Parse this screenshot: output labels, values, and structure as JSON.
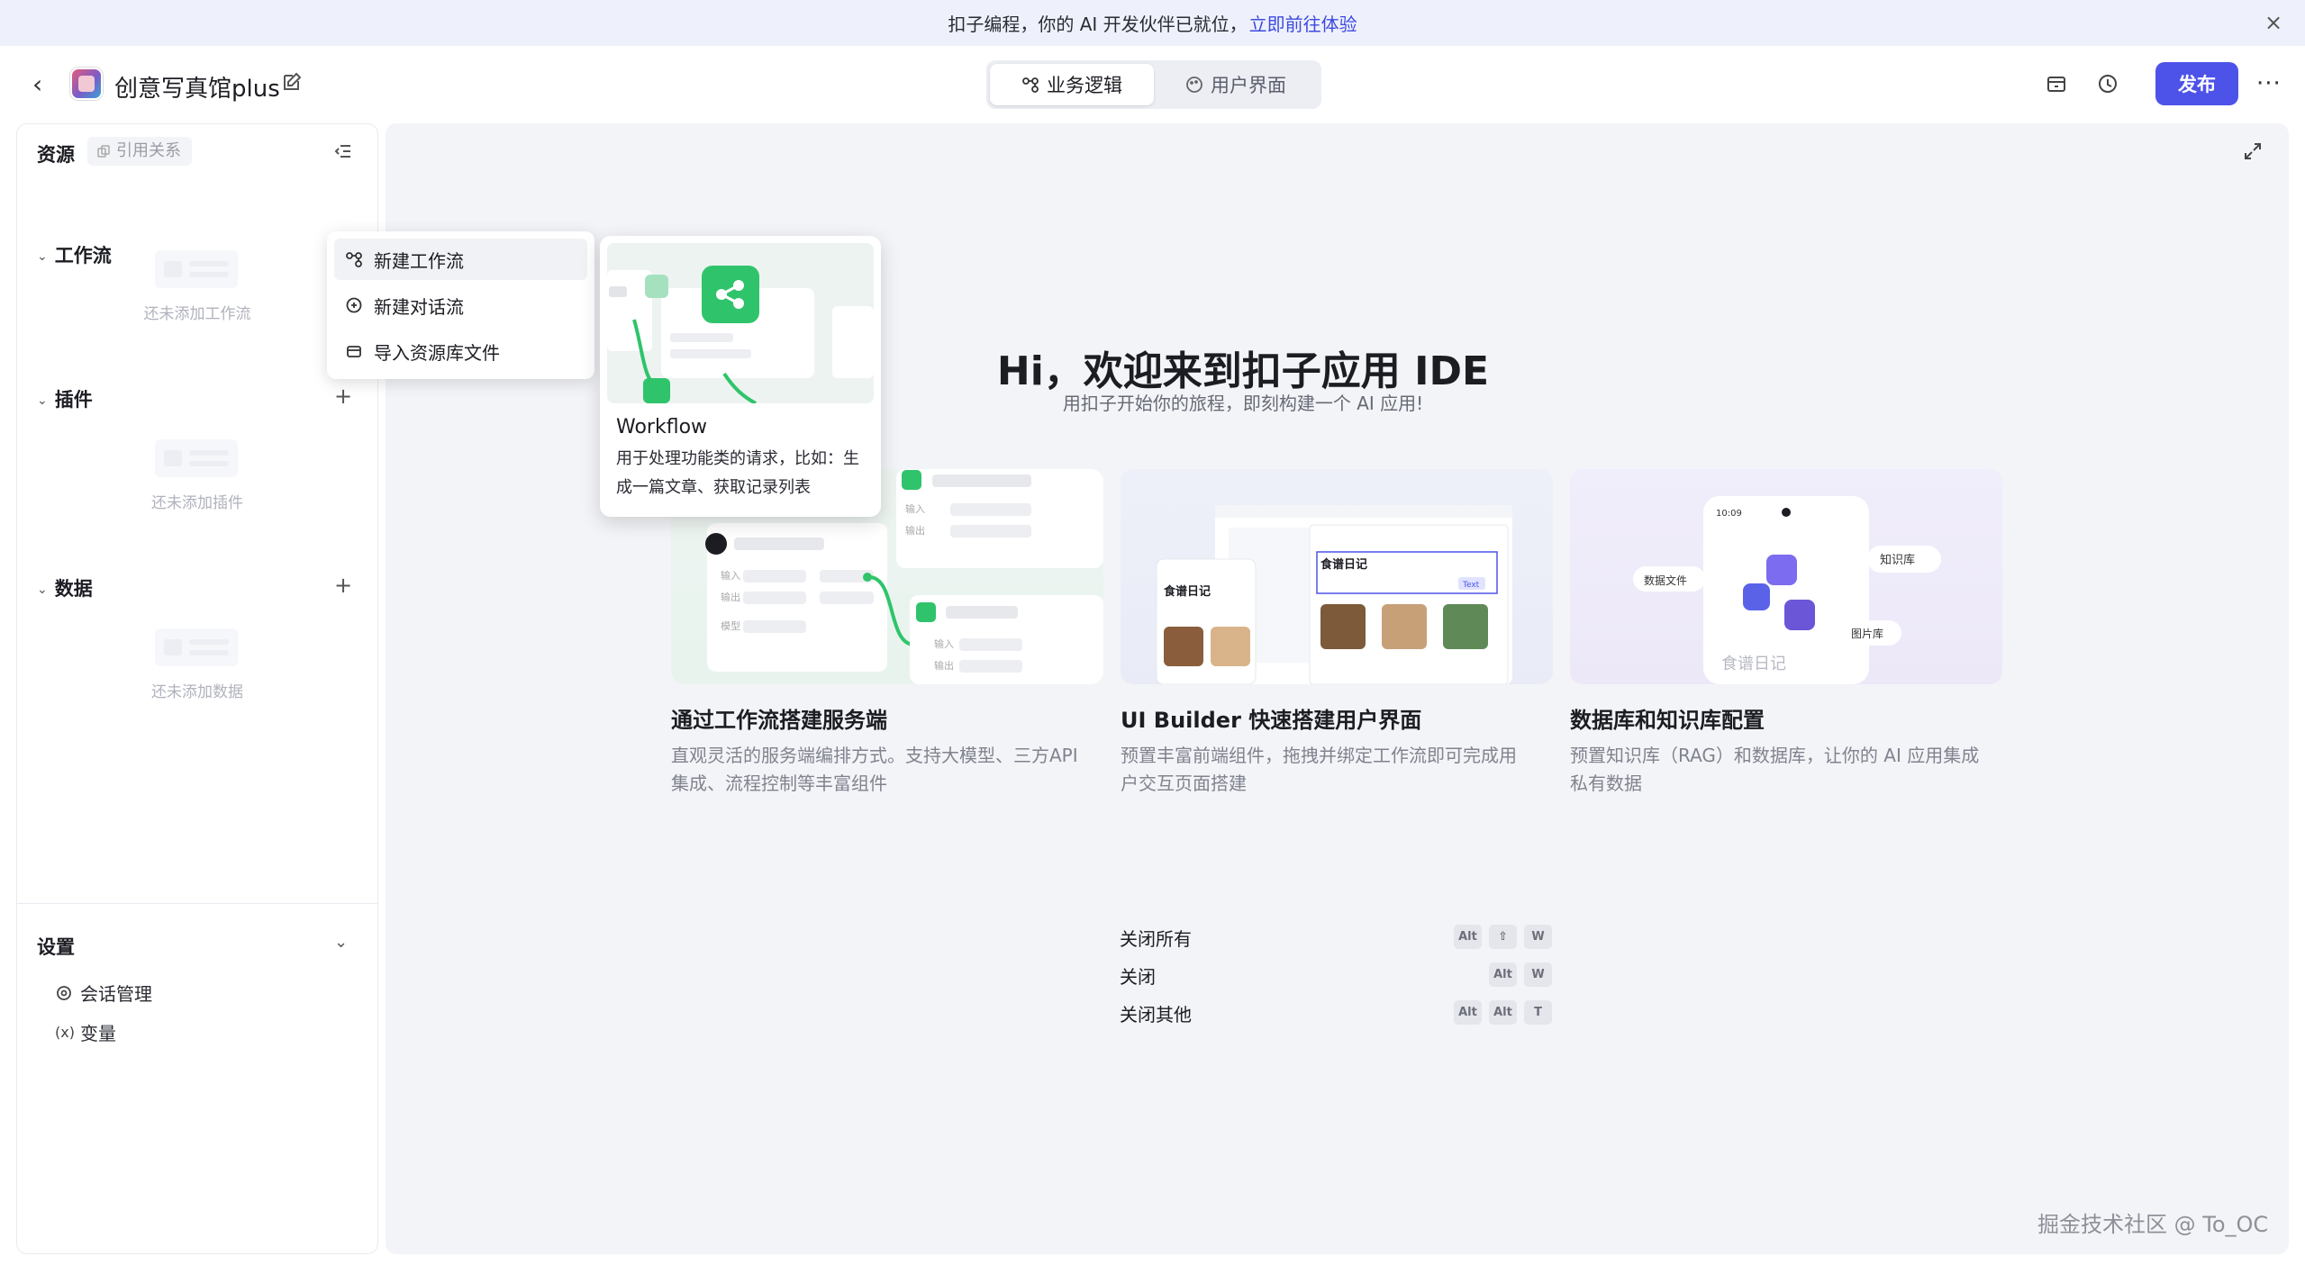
{
  "banner": {
    "text": "扣子编程，你的 AI 开发伙伴已就位，",
    "link": "立即前往体验"
  },
  "header": {
    "app_title": "创意写真馆plus",
    "tabs": [
      {
        "label": "业务逻辑",
        "active": true
      },
      {
        "label": "用户界面",
        "active": false
      }
    ],
    "publish_label": "发布"
  },
  "sidebar": {
    "title": "资源",
    "ref_tag": "引用关系",
    "sections": [
      {
        "title": "工作流",
        "empty_text": "还未添加工作流"
      },
      {
        "title": "插件",
        "empty_text": "还未添加插件"
      },
      {
        "title": "数据",
        "empty_text": "还未添加数据"
      }
    ],
    "settings": {
      "title": "设置",
      "items": [
        {
          "label": "会话管理",
          "icon": "chat-settings-icon"
        },
        {
          "label": "变量",
          "icon": "variable-icon",
          "glyph": "(x)"
        }
      ]
    }
  },
  "dropdown": {
    "items": [
      {
        "label": "新建工作流",
        "icon": "workflow-icon"
      },
      {
        "label": "新建对话流",
        "icon": "chatflow-icon"
      },
      {
        "label": "导入资源库文件",
        "icon": "import-icon"
      }
    ]
  },
  "preview": {
    "title": "Workflow",
    "description": "用于处理功能类的请求，比如：生成一篇文章、获取记录列表"
  },
  "hero": {
    "title": "Hi，欢迎来到扣子应用 IDE",
    "subtitle": "用扣子开始你的旅程，即刻构建一个 AI 应用!"
  },
  "cards": [
    {
      "title": "通过工作流搭建服务端",
      "desc_line1": "直观灵活的服务端编排方式。支持大模型、三方API",
      "desc_line2": "集成、流程控制等丰富组件",
      "img_labels": [
        "输入",
        "输出",
        "模型",
        "输入",
        "输出"
      ]
    },
    {
      "title": "UI Builder 快速搭建用户界面",
      "desc_line1": "预置丰富前端组件，拖拽并绑定工作流即可完成用",
      "desc_line2": "户交互页面搭建",
      "img_labels": [
        "食谱日记",
        "食谱日记",
        "Text"
      ]
    },
    {
      "title": "数据库和知识库配置",
      "desc_line1": "预置知识库（RAG）和数据库，让你的 AI 应用集成",
      "desc_line2": "私有数据",
      "img_labels": [
        "数据文件",
        "知识库",
        "图片库",
        "食谱日记",
        "10:09"
      ]
    }
  ],
  "shortcuts": [
    {
      "label": "关闭所有",
      "keys": [
        "Alt",
        "⇧",
        "W"
      ]
    },
    {
      "label": "关闭",
      "keys": [
        "Alt",
        "W"
      ]
    },
    {
      "label": "关闭其他",
      "keys": [
        "Alt",
        "Alt",
        "T"
      ]
    }
  ],
  "watermark": "掘金技术社区 @ To_OC",
  "colors": {
    "accent": "#4d53e8",
    "link": "#3d4ae0",
    "main_bg": "#f3f4f7",
    "banner_bg": "#eef1fb",
    "workflow_green": "#2fc46b"
  }
}
